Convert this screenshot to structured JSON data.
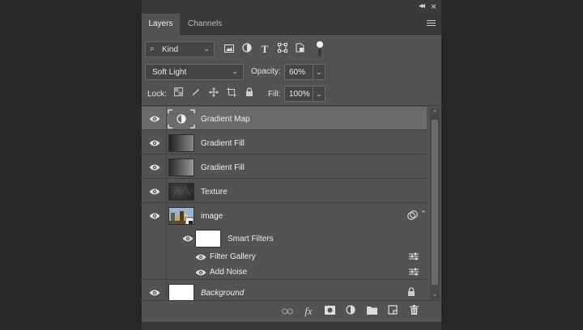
{
  "panel": {
    "tabs": [
      {
        "label": "Layers",
        "active": true
      },
      {
        "label": "Channels",
        "active": false
      }
    ]
  },
  "filter": {
    "kind_label": "Kind",
    "icons": [
      "image-filter-icon",
      "adjustment-filter-icon",
      "type-filter-icon",
      "shape-filter-icon",
      "smart-object-filter-icon",
      "filter-toggle-icon"
    ]
  },
  "blend": {
    "mode": "Soft Light",
    "opacity_label": "Opacity:",
    "opacity_value": "60%"
  },
  "lock": {
    "label": "Lock:",
    "icons": [
      "lock-transparent-pixels-icon",
      "lock-image-pixels-icon",
      "lock-position-icon",
      "lock-artboard-icon",
      "lock-all-icon"
    ],
    "fill_label": "Fill:",
    "fill_value": "100%"
  },
  "layers": [
    {
      "name": "Gradient Map",
      "selected": true,
      "thumb": "adjustment"
    },
    {
      "name": "Gradient Fill",
      "selected": false,
      "thumb": "gradient"
    },
    {
      "name": "Gradient Fill",
      "selected": false,
      "thumb": "gradient"
    },
    {
      "name": "Texture",
      "selected": false,
      "thumb": "texture"
    },
    {
      "name": "image",
      "selected": false,
      "thumb": "photo"
    },
    {
      "name": "Smart Filters",
      "selected": false,
      "thumb": "white"
    },
    {
      "name": "Filter Gallery",
      "selected": false
    },
    {
      "name": "Add Noise",
      "selected": false
    },
    {
      "name": "Background",
      "selected": false,
      "thumb": "white",
      "italic": true
    }
  ],
  "footer": {
    "icons": [
      "link-layers-icon",
      "fx-icon",
      "add-mask-icon",
      "new-adjustment-icon",
      "new-group-icon",
      "new-layer-icon",
      "delete-layer-icon"
    ]
  },
  "colors": {
    "panel_bg": "#535353",
    "selected_bg": "#6a6a6a",
    "app_bg": "#282828"
  }
}
